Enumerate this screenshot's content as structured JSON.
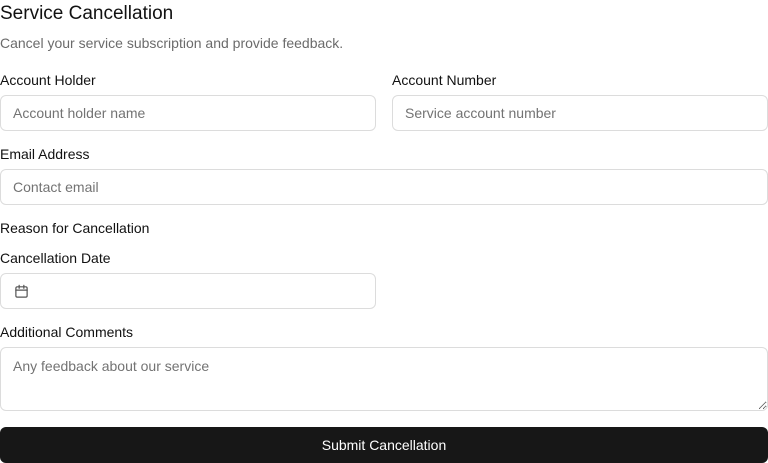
{
  "form": {
    "title": "Service Cancellation",
    "subtitle": "Cancel your service subscription and provide feedback.",
    "account_holder": {
      "label": "Account Holder",
      "placeholder": "Account holder name",
      "value": ""
    },
    "account_number": {
      "label": "Account Number",
      "placeholder": "Service account number",
      "value": ""
    },
    "email": {
      "label": "Email Address",
      "placeholder": "Contact email",
      "value": ""
    },
    "reason": {
      "label": "Reason for Cancellation"
    },
    "cancellation_date": {
      "label": "Cancellation Date",
      "value": "",
      "icon": "calendar-icon"
    },
    "comments": {
      "label": "Additional Comments",
      "placeholder": "Any feedback about our service",
      "value": ""
    },
    "submit_label": "Submit Cancellation"
  },
  "colors": {
    "button_bg": "#171717",
    "button_text": "#ffffff",
    "border": "#dcdcdc",
    "muted_text": "#6b6b6b"
  }
}
